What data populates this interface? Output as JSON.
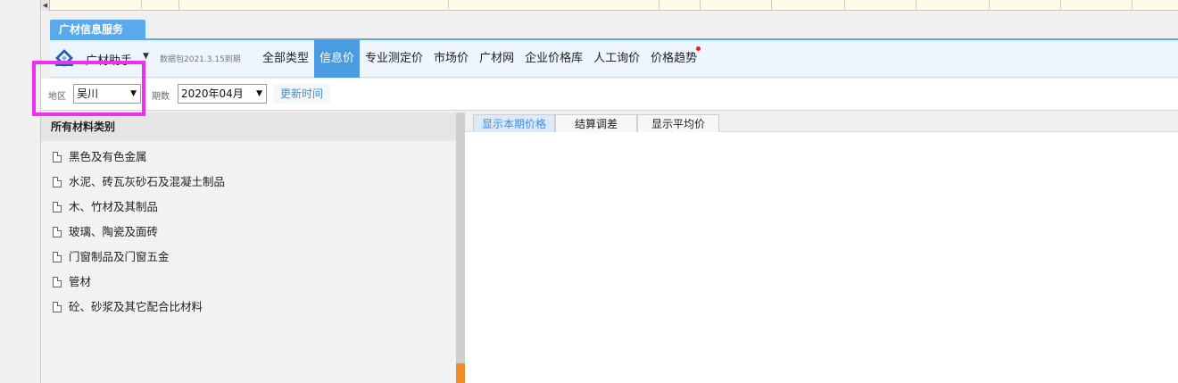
{
  "service_tab": {
    "label": "广材信息服务"
  },
  "nav": {
    "app_name": "广材助手",
    "package_info": "数据包2021.3.15到期",
    "items": [
      {
        "label": "全部类型",
        "active": false
      },
      {
        "label": "信息价",
        "active": true
      },
      {
        "label": "专业测定价",
        "active": false
      },
      {
        "label": "市场价",
        "active": false
      },
      {
        "label": "广材网",
        "active": false
      },
      {
        "label": "企业价格库",
        "active": false
      },
      {
        "label": "人工询价",
        "active": false
      },
      {
        "label": "价格趋势",
        "active": false,
        "has_dot": true
      }
    ]
  },
  "filters": {
    "region_label": "地区",
    "region_value": "吴川",
    "period_label": "期数",
    "period_value": "2020年04月",
    "update_button": "更新时间"
  },
  "categories": {
    "header": "所有材料类别",
    "items": [
      "黑色及有色金属",
      "水泥、砖瓦灰砂石及混凝土制品",
      "木、竹材及其制品",
      "玻璃、陶瓷及面砖",
      "门窗制品及门窗五金",
      "管材",
      "砼、砂浆及其它配合比材料"
    ]
  },
  "right_tabs": [
    {
      "label": "显示本期价格",
      "active": true
    },
    {
      "label": "结算调差",
      "active": false
    },
    {
      "label": "显示平均价",
      "active": false
    }
  ],
  "colors": {
    "accent": "#4b9be0",
    "highlight": "#f02ef0",
    "splitter_marker": "#f08a2a"
  }
}
